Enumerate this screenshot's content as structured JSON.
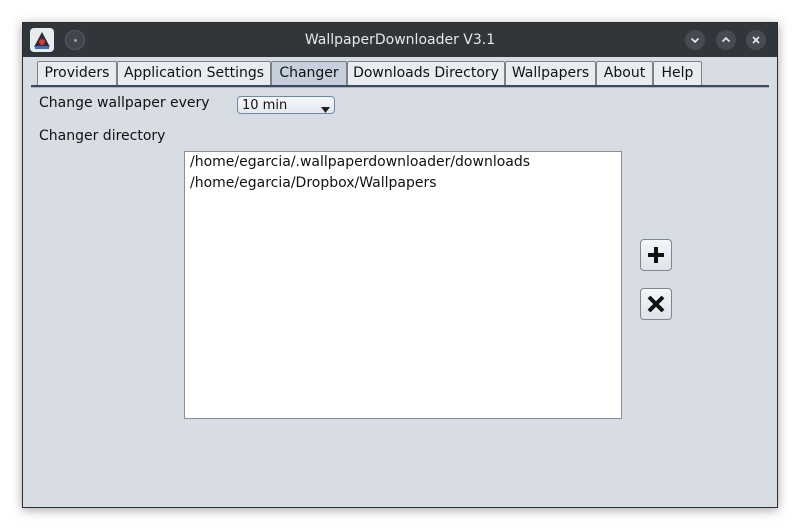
{
  "window": {
    "title": "WallpaperDownloader V3.1"
  },
  "titlebar": {
    "app_icon": "java-app-icon",
    "menu_button_icon": "window-menu-dot-icon",
    "controls": [
      "minimize-icon",
      "maximize-icon",
      "close-icon"
    ]
  },
  "tabs": [
    {
      "label": "Providers",
      "active": false
    },
    {
      "label": "Application Settings",
      "active": false
    },
    {
      "label": "Changer",
      "active": true
    },
    {
      "label": "Downloads Directory",
      "active": false
    },
    {
      "label": "Wallpapers",
      "active": false
    },
    {
      "label": "About",
      "active": false
    },
    {
      "label": "Help",
      "active": false
    }
  ],
  "changer": {
    "interval_label": "Change wallpaper every",
    "interval_value": "10 min",
    "directory_label": "Changer directory",
    "directories": [
      "/home/egarcia/.wallpaperdownloader/downloads",
      "/home/egarcia/Dropbox/Wallpapers"
    ],
    "add_button_icon": "plus-icon",
    "remove_button_icon": "x-delete-icon"
  },
  "colors": {
    "titlebar": "#31363b",
    "window_bg": "#d8dce3",
    "active_tab": "#c6d0dc",
    "tab_rule": "#3b4a63"
  }
}
